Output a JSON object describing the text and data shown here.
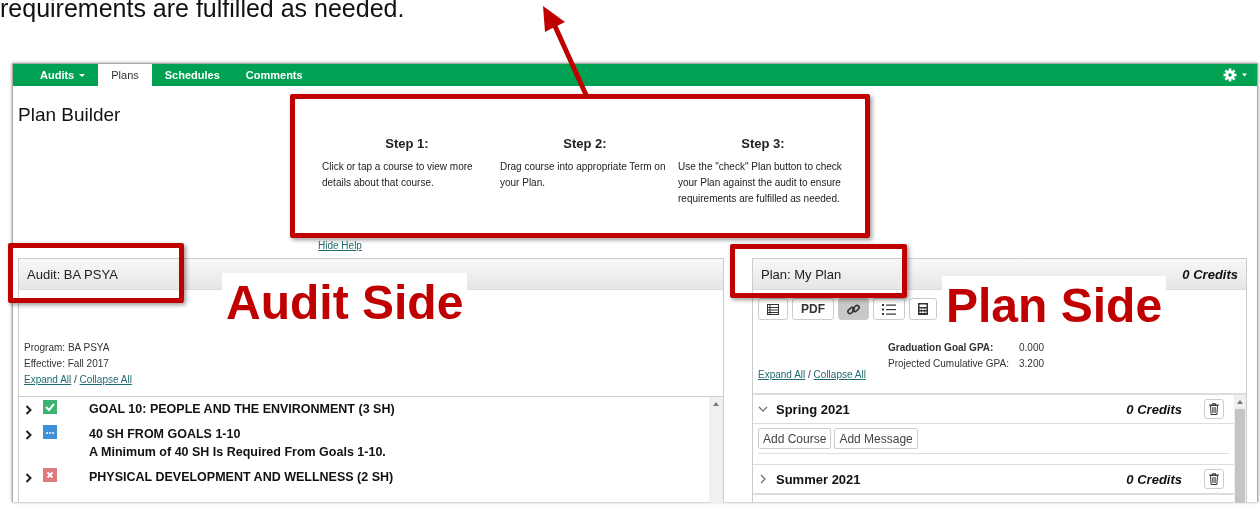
{
  "caption": "requirements are fulfilled as needed.",
  "nav": {
    "tabs": [
      {
        "label": "Audits",
        "dropdown": true,
        "selected": false
      },
      {
        "label": "Plans",
        "dropdown": false,
        "selected": true
      },
      {
        "label": "Schedules",
        "dropdown": false,
        "selected": false
      },
      {
        "label": "Comments",
        "dropdown": false,
        "selected": false
      }
    ]
  },
  "page_title": "Plan Builder",
  "help": {
    "steps": [
      {
        "title": "Step 1:",
        "text": "Click or tap a course to view more details about that course."
      },
      {
        "title": "Step 2:",
        "text": "Drag course into appropriate Term on your Plan."
      },
      {
        "title": "Step 3:",
        "text": "Use the \"check\" Plan button to check your Plan against the audit to ensure requirements are fulfilled as needed."
      }
    ],
    "hide_link": "Hide Help"
  },
  "audit": {
    "title": "Audit: BA PSYA",
    "program": "Program: BA PSYA",
    "effective": "Effective: Fall 2017",
    "expand": "Expand All",
    "separator": "/",
    "collapse": "Collapse All",
    "requirements": [
      {
        "kind": "complete",
        "title": "GOAL 10: PEOPLE AND THE ENVIRONMENT (3 SH)"
      },
      {
        "kind": "in_progress",
        "title": "40 SH FROM GOALS 1-10",
        "note": "A Minimum of 40 SH Is Required From Goals 1-10."
      },
      {
        "kind": "not_met",
        "title": "PHYSICAL DEVELOPMENT AND WELLNESS (2 SH)"
      }
    ]
  },
  "plan": {
    "title": "Plan: My Plan",
    "credits": "0 Credits",
    "toolbar": [
      {
        "kind": "grid",
        "selected": false
      },
      {
        "kind": "text",
        "label": "PDF",
        "selected": false
      },
      {
        "kind": "link",
        "selected": true
      },
      {
        "kind": "list",
        "selected": false
      },
      {
        "kind": "calculator",
        "selected": false
      }
    ],
    "gpa": [
      {
        "label": "Graduation Goal GPA:",
        "value": "0.000",
        "bold": true
      },
      {
        "label": "Projected Cumulative GPA:",
        "value": "3.200",
        "bold": false
      }
    ],
    "expand": "Expand All",
    "separator": "/",
    "collapse": "Collapse All",
    "terms": [
      {
        "name": "Spring 2021",
        "credits": "0 Credits",
        "expanded": true,
        "buttons": [
          "Add Course",
          "Add Message"
        ]
      },
      {
        "name": "Summer 2021",
        "credits": "0 Credits",
        "expanded": false
      }
    ]
  },
  "annotations": {
    "labels": [
      "Audit Side",
      "Plan Side"
    ]
  }
}
